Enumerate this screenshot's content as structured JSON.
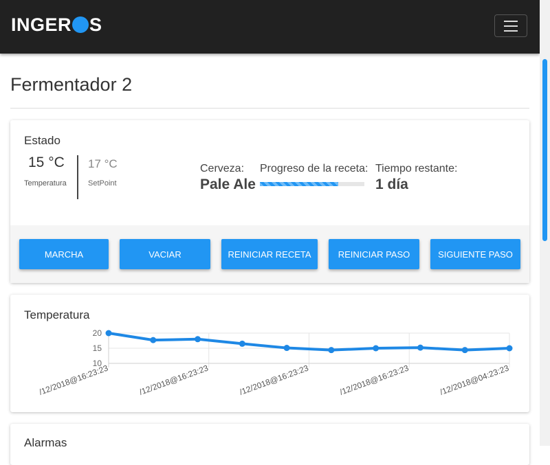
{
  "brand": {
    "name_left": "INGER",
    "name_right": "S"
  },
  "page": {
    "title": "Fermentador 2"
  },
  "estado": {
    "title": "Estado",
    "temperature": {
      "value": "15 °C",
      "label": "Temperatura"
    },
    "setpoint": {
      "value": "17 °C",
      "label": "SetPoint"
    },
    "beer": {
      "label": "Cerveza:",
      "value": "Pale Ale"
    },
    "progress": {
      "label": "Progreso de la receta:",
      "fraction": 0.75
    },
    "remaining": {
      "label": "Tiempo restante:",
      "value": "1 día"
    },
    "buttons": [
      "MARCHA",
      "VACIAR",
      "REINICIAR RECETA",
      "REINICIAR PASO",
      "SIGUIENTE PASO"
    ]
  },
  "temperature_card": {
    "title": "Temperatura"
  },
  "alarm_card": {
    "title": "Alarmas"
  },
  "chart_data": {
    "type": "line",
    "title": "Temperatura",
    "ylim": [
      10,
      20
    ],
    "yticks": [
      10,
      15,
      20
    ],
    "x_tick_labels": [
      "/12/2018@16:23:23",
      "/12/2018@16:23:23",
      "/12/2018@16:23:23",
      "/12/2018@16:23:23",
      "/12/2018@04:23:23"
    ],
    "series": [
      {
        "values": [
          20,
          17.7,
          18,
          16.5,
          15.1,
          14.4,
          15,
          15.2,
          14.4,
          15
        ]
      }
    ],
    "color": "#1e88e5",
    "grid": true
  },
  "colors": {
    "accent": "#2196f3",
    "navbar": "#212121"
  }
}
